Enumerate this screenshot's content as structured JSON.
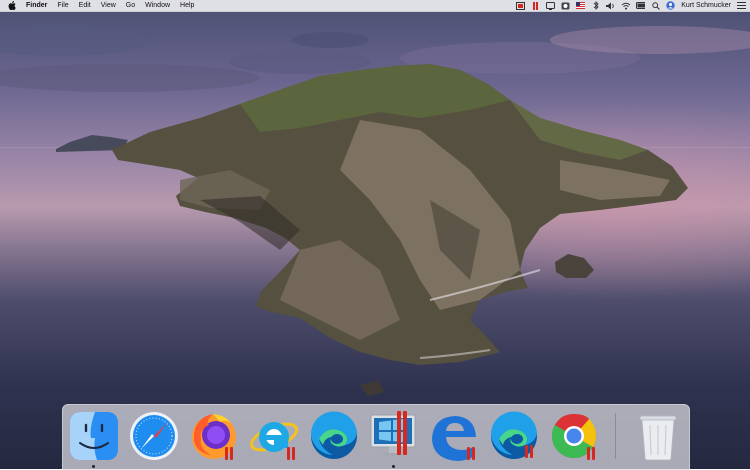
{
  "menubar": {
    "apple_icon": "apple-icon",
    "app_name": "Finder",
    "menus": [
      "File",
      "Edit",
      "View",
      "Go",
      "Window",
      "Help"
    ],
    "status_icons": [
      "parallels-icon",
      "pause-icon",
      "display-icon",
      "record-icon",
      "flag-us-icon",
      "bluetooth-icon",
      "volume-icon",
      "wifi-icon",
      "battery-icon",
      "search-icon",
      "user-icon"
    ],
    "user_name": "Kurt Schmucker",
    "list_icon": "list-icon"
  },
  "dock": {
    "items": [
      {
        "name": "finder-icon",
        "running": true
      },
      {
        "name": "safari-icon",
        "running": false
      },
      {
        "name": "firefox-icon",
        "running": false,
        "parallels": true
      },
      {
        "name": "internet-explorer-icon",
        "running": false,
        "parallels": true
      },
      {
        "name": "edge-icon",
        "running": false
      },
      {
        "name": "windows-pc-icon",
        "running": true,
        "parallels": true
      },
      {
        "name": "edge-legacy-icon",
        "running": false,
        "parallels": true
      },
      {
        "name": "edge-parallels-icon",
        "running": false,
        "parallels": true
      },
      {
        "name": "chrome-icon",
        "running": false,
        "parallels": true
      },
      {
        "name": "trash-icon",
        "running": false
      }
    ]
  },
  "colors": {
    "parallels_red": "#d5281e",
    "menubar_bg": "#ececf0",
    "dock_bg": "#dcdce2"
  }
}
